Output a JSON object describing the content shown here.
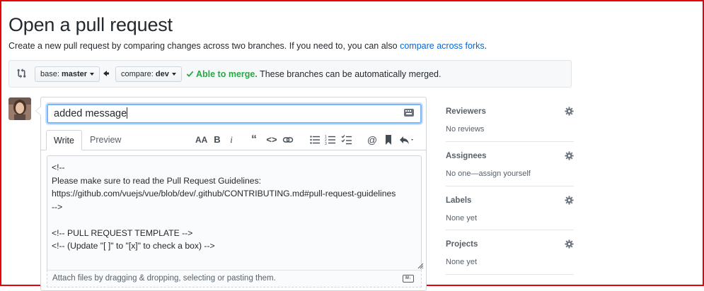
{
  "page": {
    "title": "Open a pull request",
    "subtitle_text": "Create a new pull request by comparing changes across two branches. If you need to, you can also ",
    "subtitle_link": "compare across forks",
    "subtitle_end": "."
  },
  "compare": {
    "base_prefix": "base: ",
    "base_branch": "master",
    "compare_prefix": "compare: ",
    "compare_branch": "dev",
    "merge_ok": "Able to merge.",
    "merge_text": " These branches can be automatically merged."
  },
  "editor": {
    "title_value": "added message",
    "tabs": {
      "write": "Write",
      "preview": "Preview"
    },
    "toolbar_icons": [
      "text-size-icon",
      "bold-icon",
      "italic-icon",
      "quote-icon",
      "code-icon",
      "link-icon",
      "bulleted-list-icon",
      "numbered-list-icon",
      "task-list-icon",
      "mention-icon",
      "bookmark-icon",
      "reply-icon"
    ],
    "body": "<!--\nPlease make sure to read the Pull Request Guidelines:\nhttps://github.com/vuejs/vue/blob/dev/.github/CONTRIBUTING.md#pull-request-guidelines\n-->\n\n<!-- PULL REQUEST TEMPLATE -->\n<!-- (Update \"[ ]\" to \"[x]\" to check a box) -->",
    "attach_text": "Attach files by dragging & dropping, selecting or pasting them.",
    "markdown_badge": "M↓"
  },
  "sidebar": {
    "reviewers": {
      "label": "Reviewers",
      "value": "No reviews"
    },
    "assignees": {
      "label": "Assignees",
      "value": "No one—assign yourself"
    },
    "labels": {
      "label": "Labels",
      "value": "None yet"
    },
    "projects": {
      "label": "Projects",
      "value": "None yet"
    }
  },
  "colors": {
    "link": "#0366d6",
    "success": "#28a745",
    "frame": "#e8000b"
  }
}
